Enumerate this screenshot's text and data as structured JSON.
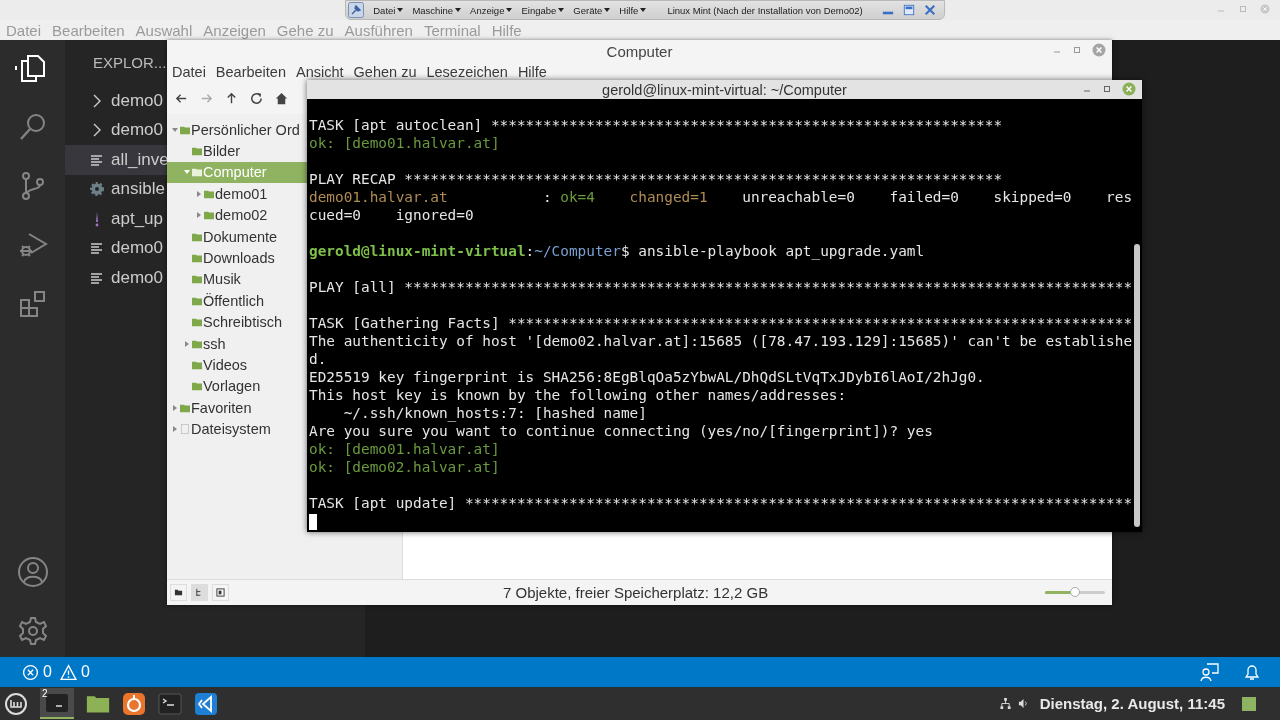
{
  "vm_bar": {
    "menus": [
      "Datei",
      "Maschine",
      "Anzeige",
      "Eingabe",
      "Geräte",
      "Hilfe"
    ],
    "title": "Linux Mint (Nach der Installation von Demo02)"
  },
  "vscode": {
    "menu": [
      "Datei",
      "Bearbeiten",
      "Auswahl",
      "Anzeigen",
      "Gehe zu",
      "Ausführen",
      "Terminal",
      "Hilfe"
    ],
    "explorer_title": "EXPLOR...",
    "files": [
      {
        "kind": "folder",
        "name": "demo0",
        "selected": false
      },
      {
        "kind": "folder",
        "name": "demo0",
        "selected": false
      },
      {
        "kind": "file",
        "name": "all_inve",
        "selected": true
      },
      {
        "kind": "gear",
        "name": "ansible",
        "selected": false
      },
      {
        "kind": "yaml",
        "name": "apt_up",
        "selected": false
      },
      {
        "kind": "file",
        "name": "demo0",
        "selected": false
      },
      {
        "kind": "file",
        "name": "demo0",
        "selected": false
      }
    ],
    "status": {
      "errors": "0",
      "warnings": "0"
    }
  },
  "file_manager": {
    "title": "Computer",
    "menu": [
      "Datei",
      "Bearbeiten",
      "Ansicht",
      "Gehen zu",
      "Lesezeichen",
      "Hilfe"
    ],
    "tree": [
      {
        "kind": "folder",
        "label": "Persönlicher Ord",
        "selected": false,
        "expanded": true,
        "children": [
          {
            "kind": "folder",
            "label": "Bilder",
            "selected": false
          },
          {
            "kind": "folder",
            "label": "Computer",
            "selected": true,
            "expanded": true,
            "children": [
              {
                "kind": "folder",
                "label": "demo01",
                "selected": false,
                "expanded": false
              },
              {
                "kind": "folder",
                "label": "demo02",
                "selected": false,
                "expanded": false
              }
            ]
          },
          {
            "kind": "folder",
            "label": "Dokumente",
            "selected": false
          },
          {
            "kind": "folder",
            "label": "Downloads",
            "selected": false
          },
          {
            "kind": "folder",
            "label": "Musik",
            "selected": false
          },
          {
            "kind": "folder",
            "label": "Öffentlich",
            "selected": false
          },
          {
            "kind": "folder",
            "label": "Schreibtisch",
            "selected": false
          },
          {
            "kind": "folder",
            "label": "ssh",
            "selected": false,
            "expanded": false
          },
          {
            "kind": "folder",
            "label": "Videos",
            "selected": false
          },
          {
            "kind": "folder",
            "label": "Vorlagen",
            "selected": false
          }
        ]
      },
      {
        "kind": "folder",
        "label": "Favoriten",
        "selected": false,
        "expanded": false
      },
      {
        "kind": "drive",
        "label": "Dateisystem",
        "selected": false,
        "expanded": false
      }
    ],
    "status": "7 Objekte, freier Speicherplatz: 12,2 GB",
    "zoom": {
      "level": 0.5
    }
  },
  "terminal": {
    "title": "gerold@linux-mint-virtual: ~/Computer",
    "blocks": [
      {
        "lines": [
          [
            {
              "kind": "plain",
              "text": "TASK [apt autoclean] ***********************************************************"
            }
          ],
          [
            {
              "kind": "ok",
              "text": "ok: [demo01.halvar.at]"
            }
          ]
        ]
      },
      {
        "lines": [
          [
            {
              "kind": "plain",
              "text": "PLAY RECAP *********************************************************************"
            }
          ],
          [
            {
              "kind": "changed",
              "text": "demo01.halvar.at"
            },
            {
              "kind": "plain",
              "text": "           : "
            },
            {
              "kind": "ok",
              "text": "ok=4"
            },
            {
              "kind": "changed",
              "text": "    changed=1"
            },
            {
              "kind": "plain",
              "text": "    unreachable=0    failed=0    skipped=0    res"
            }
          ],
          [
            {
              "kind": "plain",
              "text": "cued=0    ignored=0"
            }
          ]
        ]
      },
      {
        "lines": [
          [
            {
              "kind": "user",
              "text": "gerold@linux-mint-virtual"
            },
            {
              "kind": "plain",
              "text": ":"
            },
            {
              "kind": "path",
              "text": "~/Computer"
            },
            {
              "kind": "plain",
              "text": "$ ansible-playbook apt_upgrade.yaml"
            }
          ]
        ]
      },
      {
        "lines": [
          [
            {
              "kind": "plain",
              "text": "PLAY [all] ************************************************************************************"
            }
          ]
        ]
      },
      {
        "lines": [
          [
            {
              "kind": "plain",
              "text": "TASK [Gathering Facts] ************************************************************************"
            }
          ],
          [
            {
              "kind": "plain",
              "text": "The authenticity of host '[demo02.halvar.at]:15685 ([78.47.193.129]:15685)' can't be establishe"
            }
          ],
          [
            {
              "kind": "plain",
              "text": "d."
            }
          ],
          [
            {
              "kind": "plain",
              "text": "ED25519 key fingerprint is SHA256:8EgBlqOa5zYbwAL/DhQdSLtVqTxJDybI6lAoI/2hJg0."
            }
          ],
          [
            {
              "kind": "plain",
              "text": "This host key is known by the following other names/addresses:"
            }
          ],
          [
            {
              "kind": "plain",
              "text": "    ~/.ssh/known_hosts:7: [hashed name]"
            }
          ],
          [
            {
              "kind": "plain",
              "text": "Are you sure you want to continue connecting (yes/no/[fingerprint])? yes"
            }
          ],
          [
            {
              "kind": "ok",
              "text": "ok: [demo01.halvar.at]"
            }
          ],
          [
            {
              "kind": "ok",
              "text": "ok: [demo02.halvar.at]"
            }
          ]
        ]
      },
      {
        "lines": [
          [
            {
              "kind": "plain",
              "text": "TASK [apt update] *****************************************************************************"
            }
          ]
        ]
      }
    ]
  },
  "taskbar": {
    "badge": "2",
    "clock": "Dienstag, 2. August, 11:45"
  }
}
